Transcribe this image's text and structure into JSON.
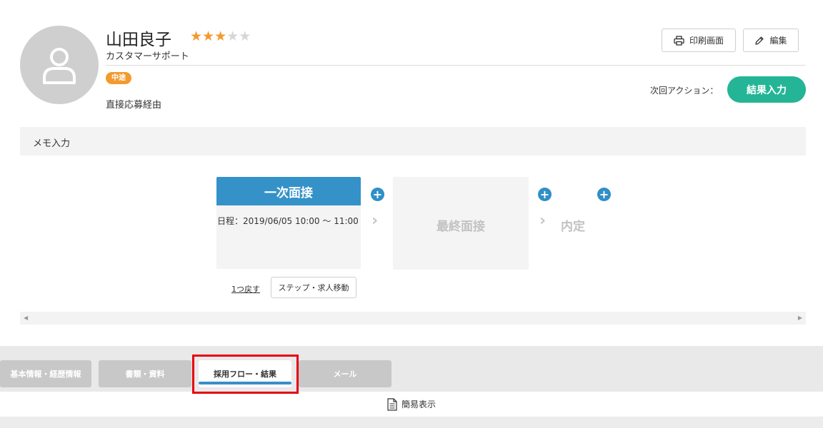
{
  "candidate": {
    "name": "山田良子",
    "rating": 3,
    "rating_max": 5,
    "department": "カスタマーサポート",
    "badge": "中途",
    "source": "直接応募経由"
  },
  "actions": {
    "print_label": "印刷画面",
    "edit_label": "編集",
    "next_action_label": "次回アクション：",
    "result_button": "結果入力"
  },
  "memo": {
    "label": "メモ入力"
  },
  "flow": {
    "current_step": {
      "title": "一次面接",
      "schedule": "日程：2019/06/05 10:00 〜 11:00"
    },
    "next_step": {
      "title": "最終面接"
    },
    "final_step": {
      "title": "内定"
    },
    "back_link": "1つ戻す",
    "move_button": "ステップ・求人移動",
    "plus_glyph": "+"
  },
  "scroll": {
    "left": "◀",
    "right": "▶"
  },
  "tabs": [
    {
      "label": "基本情報・経歴情報",
      "active": false
    },
    {
      "label": "書類・資料",
      "active": false
    },
    {
      "label": "採用フロー・結果",
      "active": true
    },
    {
      "label": "メール",
      "active": false
    }
  ],
  "simple_view": {
    "label": "簡易表示"
  },
  "colors": {
    "accent_blue": "#3492c9",
    "result_green": "#24b596",
    "badge_orange": "#f29a2e",
    "star_on": "#f39a2b",
    "star_off": "#d6d6d6",
    "highlight_red": "#e60012"
  }
}
